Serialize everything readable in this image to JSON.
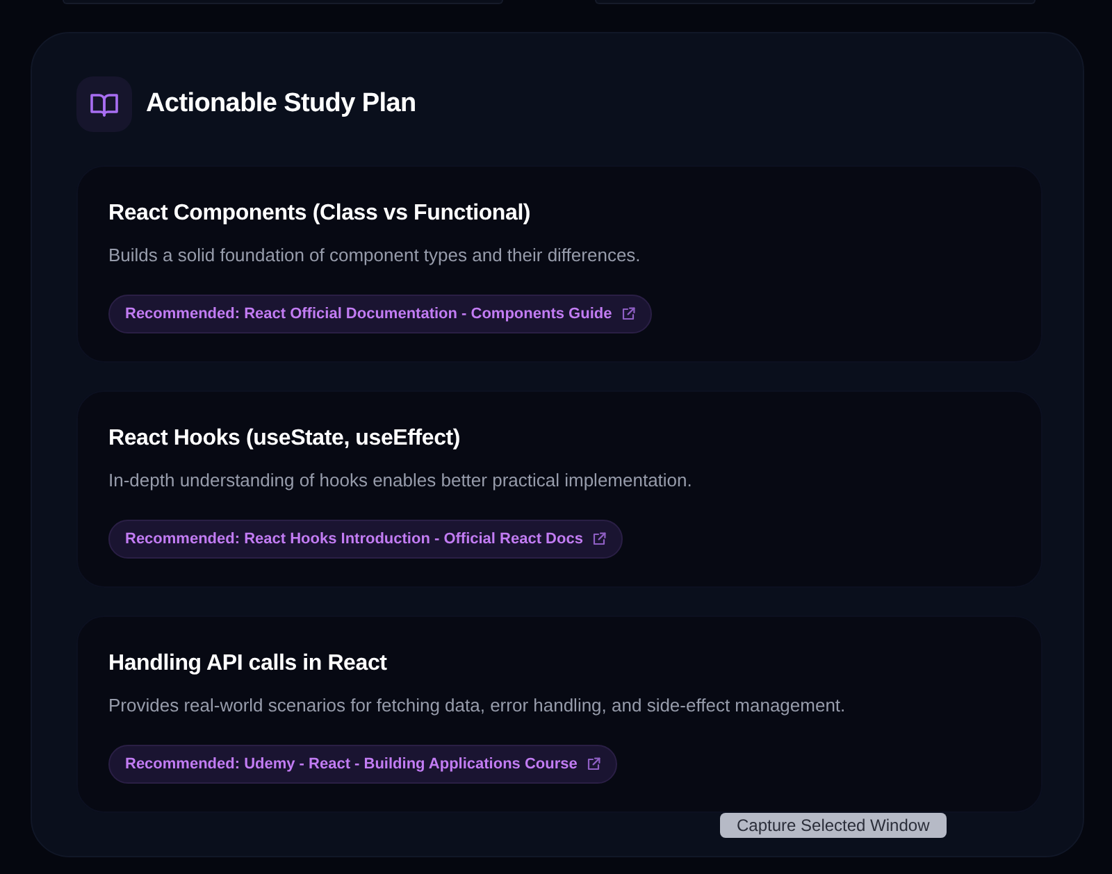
{
  "header": {
    "title": "Actionable Study Plan"
  },
  "topics": [
    {
      "title": "React Components (Class vs Functional)",
      "description": "Builds a solid foundation of component types and their differences.",
      "resource": "Recommended: React Official Documentation - Components Guide"
    },
    {
      "title": "React Hooks (useState, useEffect)",
      "description": "In-depth understanding of hooks enables better practical implementation.",
      "resource": "Recommended: React Hooks Introduction - Official React Docs"
    },
    {
      "title": "Handling API calls in React",
      "description": "Provides real-world scenarios for fetching data, error handling, and side-effect management.",
      "resource": "Recommended: Udemy - React - Building Applications Course"
    }
  ],
  "tooltip": {
    "text": "Capture Selected Window"
  }
}
